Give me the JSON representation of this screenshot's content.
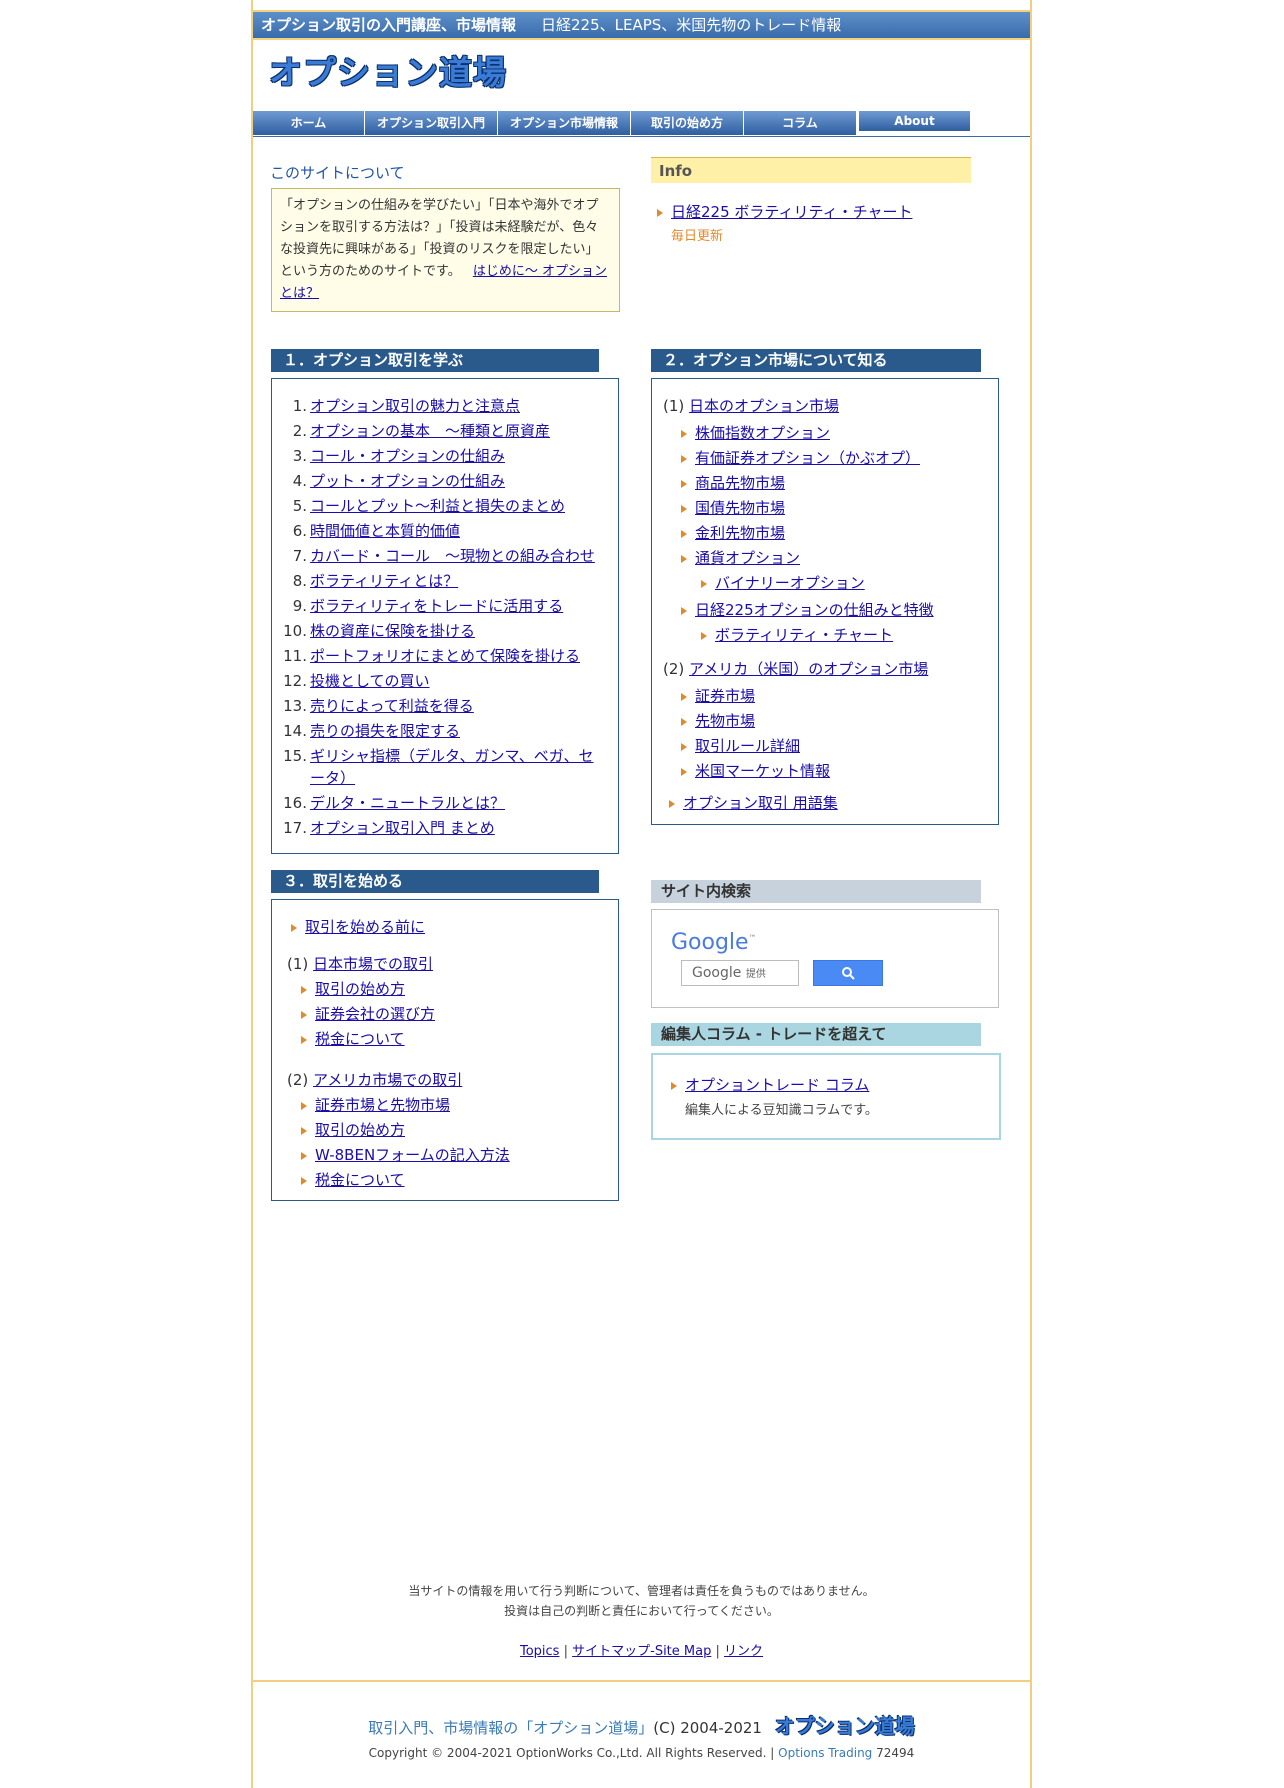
{
  "header": {
    "tagline_bold": "オプション取引の入門講座、市場情報",
    "tagline": "日経225、LEAPS、米国先物のトレード情報",
    "logo_text": "オプション道場"
  },
  "nav": [
    "ホーム",
    "オプション取引入門",
    "オプション市場情報",
    "取引の始め方",
    "コラム",
    "About"
  ],
  "about": {
    "title": "このサイトについて",
    "text": "「オプションの仕組みを学びたい」「日本や海外でオプションを取引する方法は？」「投資は未経験だが、色々な投資先に興味がある」「投資のリスクを限定したい」という方のためのサイトです。",
    "link": "はじめに～ オプションとは？"
  },
  "info": {
    "title": "Info",
    "link": "日経225 ボラティリティ・チャート",
    "note": "毎日更新"
  },
  "sec1": {
    "title": "１．オプション取引を学ぶ",
    "items": [
      "オプション取引の魅力と注意点",
      "オプションの基本　～種類と原資産",
      "コール・オプションの仕組み",
      "プット・オプションの仕組み",
      "コールとプット～利益と損失のまとめ",
      "時間価値と本質的価値",
      "カバード・コール　～現物との組み合わせ",
      "ボラティリティとは？",
      "ボラティリティをトレードに活用する",
      "株の資産に保険を掛ける",
      "ポートフォリオにまとめて保険を掛ける",
      "投機としての買い",
      "売りによって利益を得る",
      "売りの損失を限定する",
      "ギリシャ指標（デルタ、ガンマ、ベガ、セ",
      "デルタ・ニュートラルとは？",
      "オプション取引入門 まとめ"
    ],
    "item15_cont": "ータ）"
  },
  "sec2": {
    "title": "２．オプション市場について知る",
    "jp_prefix": "(1)",
    "jp_link": "日本のオプション市場",
    "jp_items": [
      "株価指数オプション",
      "有価証券オプション（かぶオプ）",
      "商品先物市場",
      "国債先物市場",
      "金利先物市場",
      "通貨オプション"
    ],
    "binary": "バイナリーオプション",
    "n225": "日経225オプションの仕組みと特徴",
    "vol": "ボラティリティ・チャート",
    "us_prefix": "(2)",
    "us_link": "アメリカ（米国）のオプション市場",
    "us_items": [
      "証券市場",
      "先物市場",
      "取引ルール詳細",
      "米国マーケット情報"
    ],
    "glossary": "オプション取引 用語集"
  },
  "sec3": {
    "title": "３．取引を始める",
    "before": "取引を始める前に",
    "jp_prefix": "(1)",
    "jp_link": "日本市場での取引",
    "jp_items": [
      "取引の始め方",
      "証券会社の選び方",
      "税金について"
    ],
    "us_prefix": "(2)",
    "us_link": "アメリカ市場での取引",
    "us_items": [
      "証券市場と先物市場",
      "取引の始め方",
      "W-8BENフォームの記入方法",
      "税金について"
    ]
  },
  "search": {
    "title": "サイト内検索",
    "google": "Google",
    "tm": "™",
    "placeholder_brand": "Google",
    "placeholder_sub": "提供"
  },
  "column": {
    "title": "編集人コラム - トレードを超えて",
    "link": "オプショントレード コラム",
    "desc": "編集人による豆知識コラムです。"
  },
  "footer": {
    "disclaimer1": "当サイトの情報を用いて行う判断について、管理者は責任を負うものではありません。",
    "disclaimer2": "投資は自己の判断と責任において行ってください。",
    "links": [
      "Topics",
      "サイトマップ-Site Map",
      "リンク"
    ],
    "sep": "|",
    "brand": "取引入門、市場情報の「オプション道場」",
    "copy": "(C) 2004-2021",
    "logo_text": "オプション道場",
    "rights": "Copyright © 2004-2021 OptionWorks Co.,Ltd. All Rights Reserved. |",
    "options_trading": "Options Trading",
    "counter": "72494"
  }
}
